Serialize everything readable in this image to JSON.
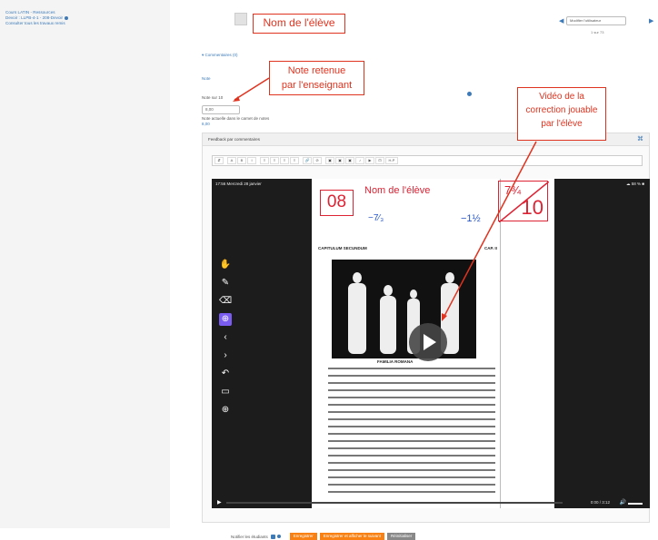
{
  "breadcrumb": {
    "line1": "Cours LATIN - Ressources",
    "line2": "Devoir : LLPB-4-1 - 208-Devoir",
    "line3": "Consulter tous les travaux remis"
  },
  "header": {
    "student_name_label": "Nom de l'élève"
  },
  "user_selector": {
    "value": "Modifier l'utilisateur",
    "filter": "1 sur 73"
  },
  "annotations": {
    "grade_note_line1": "Note retenue",
    "grade_note_line2": "par l'enseignant",
    "video_note_line1": "Vidéo de la",
    "video_note_line2": "correction jouable",
    "video_note_line3": "par l'élève",
    "accent_color": "#e0331f"
  },
  "grading": {
    "comments_toggle": "Commentaires (0)",
    "section_title": "Note",
    "grade_label": "Note sur 10",
    "grade_value": "8,00",
    "gradebook_note": "Note actuelle dans le carnet de notes",
    "gradebook_value": "8,00"
  },
  "feedback": {
    "title": "Feedback par commentaires",
    "toolbar_items": [
      "⇵",
      "A",
      "B",
      "I",
      "≡",
      "≡",
      "≡",
      "≡",
      "🔗",
      "⊘",
      "▣",
      "▣",
      "▣",
      "♪",
      "▶",
      "⊡",
      "H-P"
    ]
  },
  "video": {
    "status_left": "17:56  Mercredi 28 janvier",
    "status_right": "☁ 58 % ■",
    "score_box": "08",
    "student_name": "Nom de l'élève",
    "frac_left": "−7⁄₃",
    "frac_right": "−1½",
    "score_total_top": "7¾",
    "score_total_bottom": "10",
    "chapter_title": "CAPITULUM SECUNDUM",
    "chapter_number": "CAP. II",
    "caption": "FAMILIA ROMANA",
    "time": "0:00 / 3:12",
    "tools": [
      "hand-icon",
      "pen-icon",
      "eraser-icon",
      "crosshair-icon",
      "arrow-left-icon",
      "arrow-right-icon",
      "undo-icon",
      "rectangle-icon",
      "zoom-icon"
    ]
  },
  "footer": {
    "notify_label": "Notifier les étudiants",
    "save_label": "Enregistrer",
    "save_next_label": "Enregistrer et afficher le suivant",
    "reset_label": "Réinitialiser"
  }
}
